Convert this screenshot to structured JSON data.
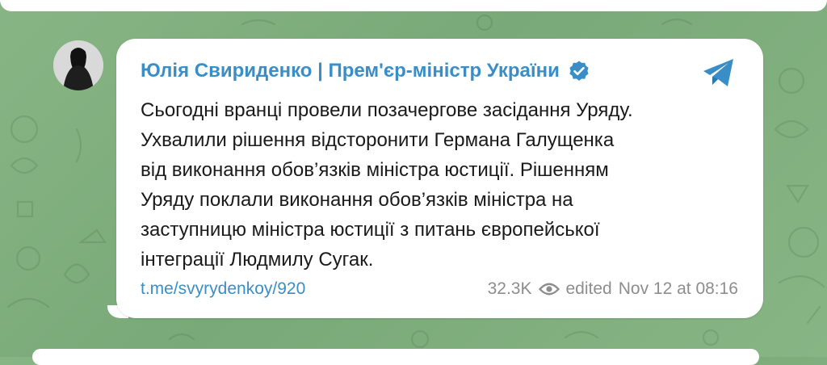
{
  "colors": {
    "background": "#7fae7d",
    "bubble": "#ffffff",
    "accent": "#3a8ec8",
    "text": "#1a1a1a",
    "meta_text": "#8d8d8d"
  },
  "post": {
    "author": "Юлія Свириденко | Прем'єр-міністр України",
    "verified_icon": "verified-badge-icon",
    "share_icon": "telegram-plane-icon",
    "message_lines": [
      "Сьогодні вранці провели позачергове засідання Уряду.",
      "Ухвалили рішення відсторонити Германа Галущенка",
      "від виконання обов’язків міністра юстиції. Рішенням",
      "Уряду поклали виконання обов’язків міністра на",
      "заступницю міністра юстиції з питань європейської",
      "інтеграції Людмилу Сугак."
    ],
    "link": "t.me/svyrydenkoy/920",
    "views": "32.3K",
    "views_icon": "eye-icon",
    "edited_label": "edited",
    "date": "Nov 12 at 08:16"
  }
}
